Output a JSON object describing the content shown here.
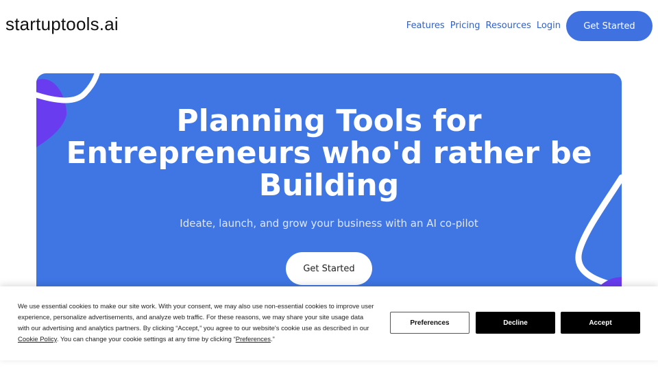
{
  "header": {
    "logo": "startuptools.ai",
    "nav": [
      "Features",
      "Pricing",
      "Resources",
      "Login"
    ],
    "cta": "Get Started"
  },
  "hero": {
    "title_lines": [
      "Planning Tools for",
      "Entrepreneurs who'd rather be",
      "Building"
    ],
    "subtitle": "Ideate, launch, and grow your business with an AI co-pilot",
    "cta": "Get Started"
  },
  "cookie": {
    "text_before_policy": "We use essential cookies to make our site work. With your consent, we may also use non-essential cookies to improve user experience, personalize advertisements, and analyze web traffic. For these reasons, we may share your site usage data with our advertising and analytics partners. By clicking “Accept,” you agree to our website's cookie use as described in our ",
    "policy_link": "Cookie Policy",
    "text_after_policy": ". You can change your cookie settings at any time by clicking “",
    "preferences_link": "Preferences",
    "text_end": ".”",
    "buttons": {
      "preferences": "Preferences",
      "decline": "Decline",
      "accept": "Accept"
    }
  },
  "colors": {
    "brand_blue": "#3f76e4",
    "nav_link": "#3160c8",
    "decor_purple": "#6a3cf0"
  }
}
